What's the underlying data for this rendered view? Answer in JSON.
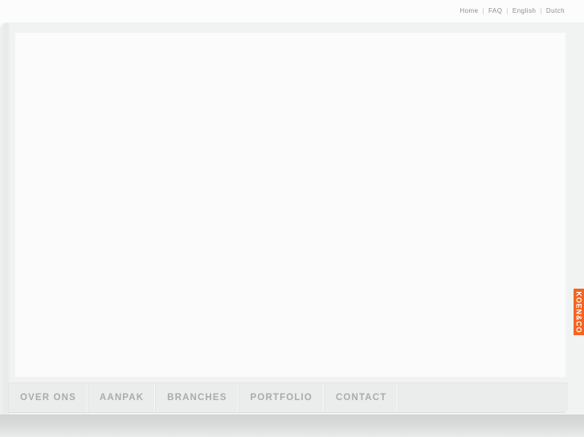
{
  "colors": {
    "page_background": "#fbfbfb",
    "frame": "#f1f2f2",
    "canvas": "#fbfbfc",
    "nav_background": "#ebecec",
    "nav_text": "#a9abac",
    "footer": "#d8d9d9",
    "accent_orange": "#f4641e"
  },
  "topnav": {
    "separator": "|",
    "items": [
      {
        "label": "Home"
      },
      {
        "label": "FAQ"
      },
      {
        "label": "English"
      },
      {
        "label": "Dutch"
      }
    ]
  },
  "mainnav": {
    "items": [
      {
        "label": "OVER ONS"
      },
      {
        "label": "AANPAK"
      },
      {
        "label": "BRANCHES"
      },
      {
        "label": "PORTFOLIO"
      },
      {
        "label": "CONTACT"
      }
    ]
  },
  "sidetab": {
    "label": "KOEN&CO"
  },
  "canvas": {
    "content": ""
  }
}
